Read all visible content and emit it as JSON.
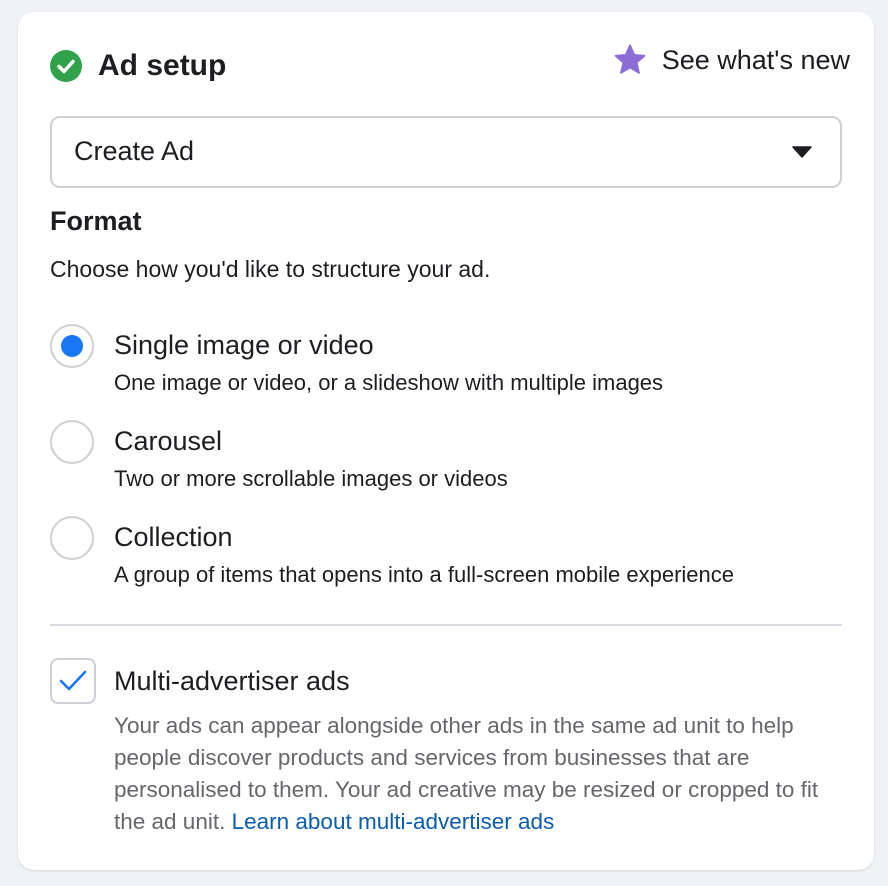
{
  "header": {
    "title": "Ad setup",
    "whats_new_label": "See what's new"
  },
  "ad_select": {
    "value": "Create Ad"
  },
  "format": {
    "title": "Format",
    "description": "Choose how you'd like to structure your ad.",
    "options": [
      {
        "title": "Single image or video",
        "description": "One image or video, or a slideshow with multiple images",
        "selected": true
      },
      {
        "title": "Carousel",
        "description": "Two or more scrollable images or videos",
        "selected": false
      },
      {
        "title": "Collection",
        "description": "A group of items that opens into a full-screen mobile experience",
        "selected": false
      }
    ]
  },
  "multi_advertiser": {
    "title": "Multi-advertiser ads",
    "checked": true,
    "description": "Your ads can appear alongside other ads in the same ad unit to help people discover products and services from businesses that are personalised to them. Your ad creative may be resized or cropped to fit the ad unit.",
    "link_text": "Learn about multi-advertiser ads"
  },
  "colors": {
    "success": "#31a24c",
    "accent": "#1877f2",
    "star": "#8c6cd6",
    "link": "#0b5cad"
  },
  "icons": {
    "status": "check-circle-icon",
    "whats_new": "star-icon",
    "dropdown": "caret-down-icon",
    "checkbox": "checkmark-icon"
  }
}
